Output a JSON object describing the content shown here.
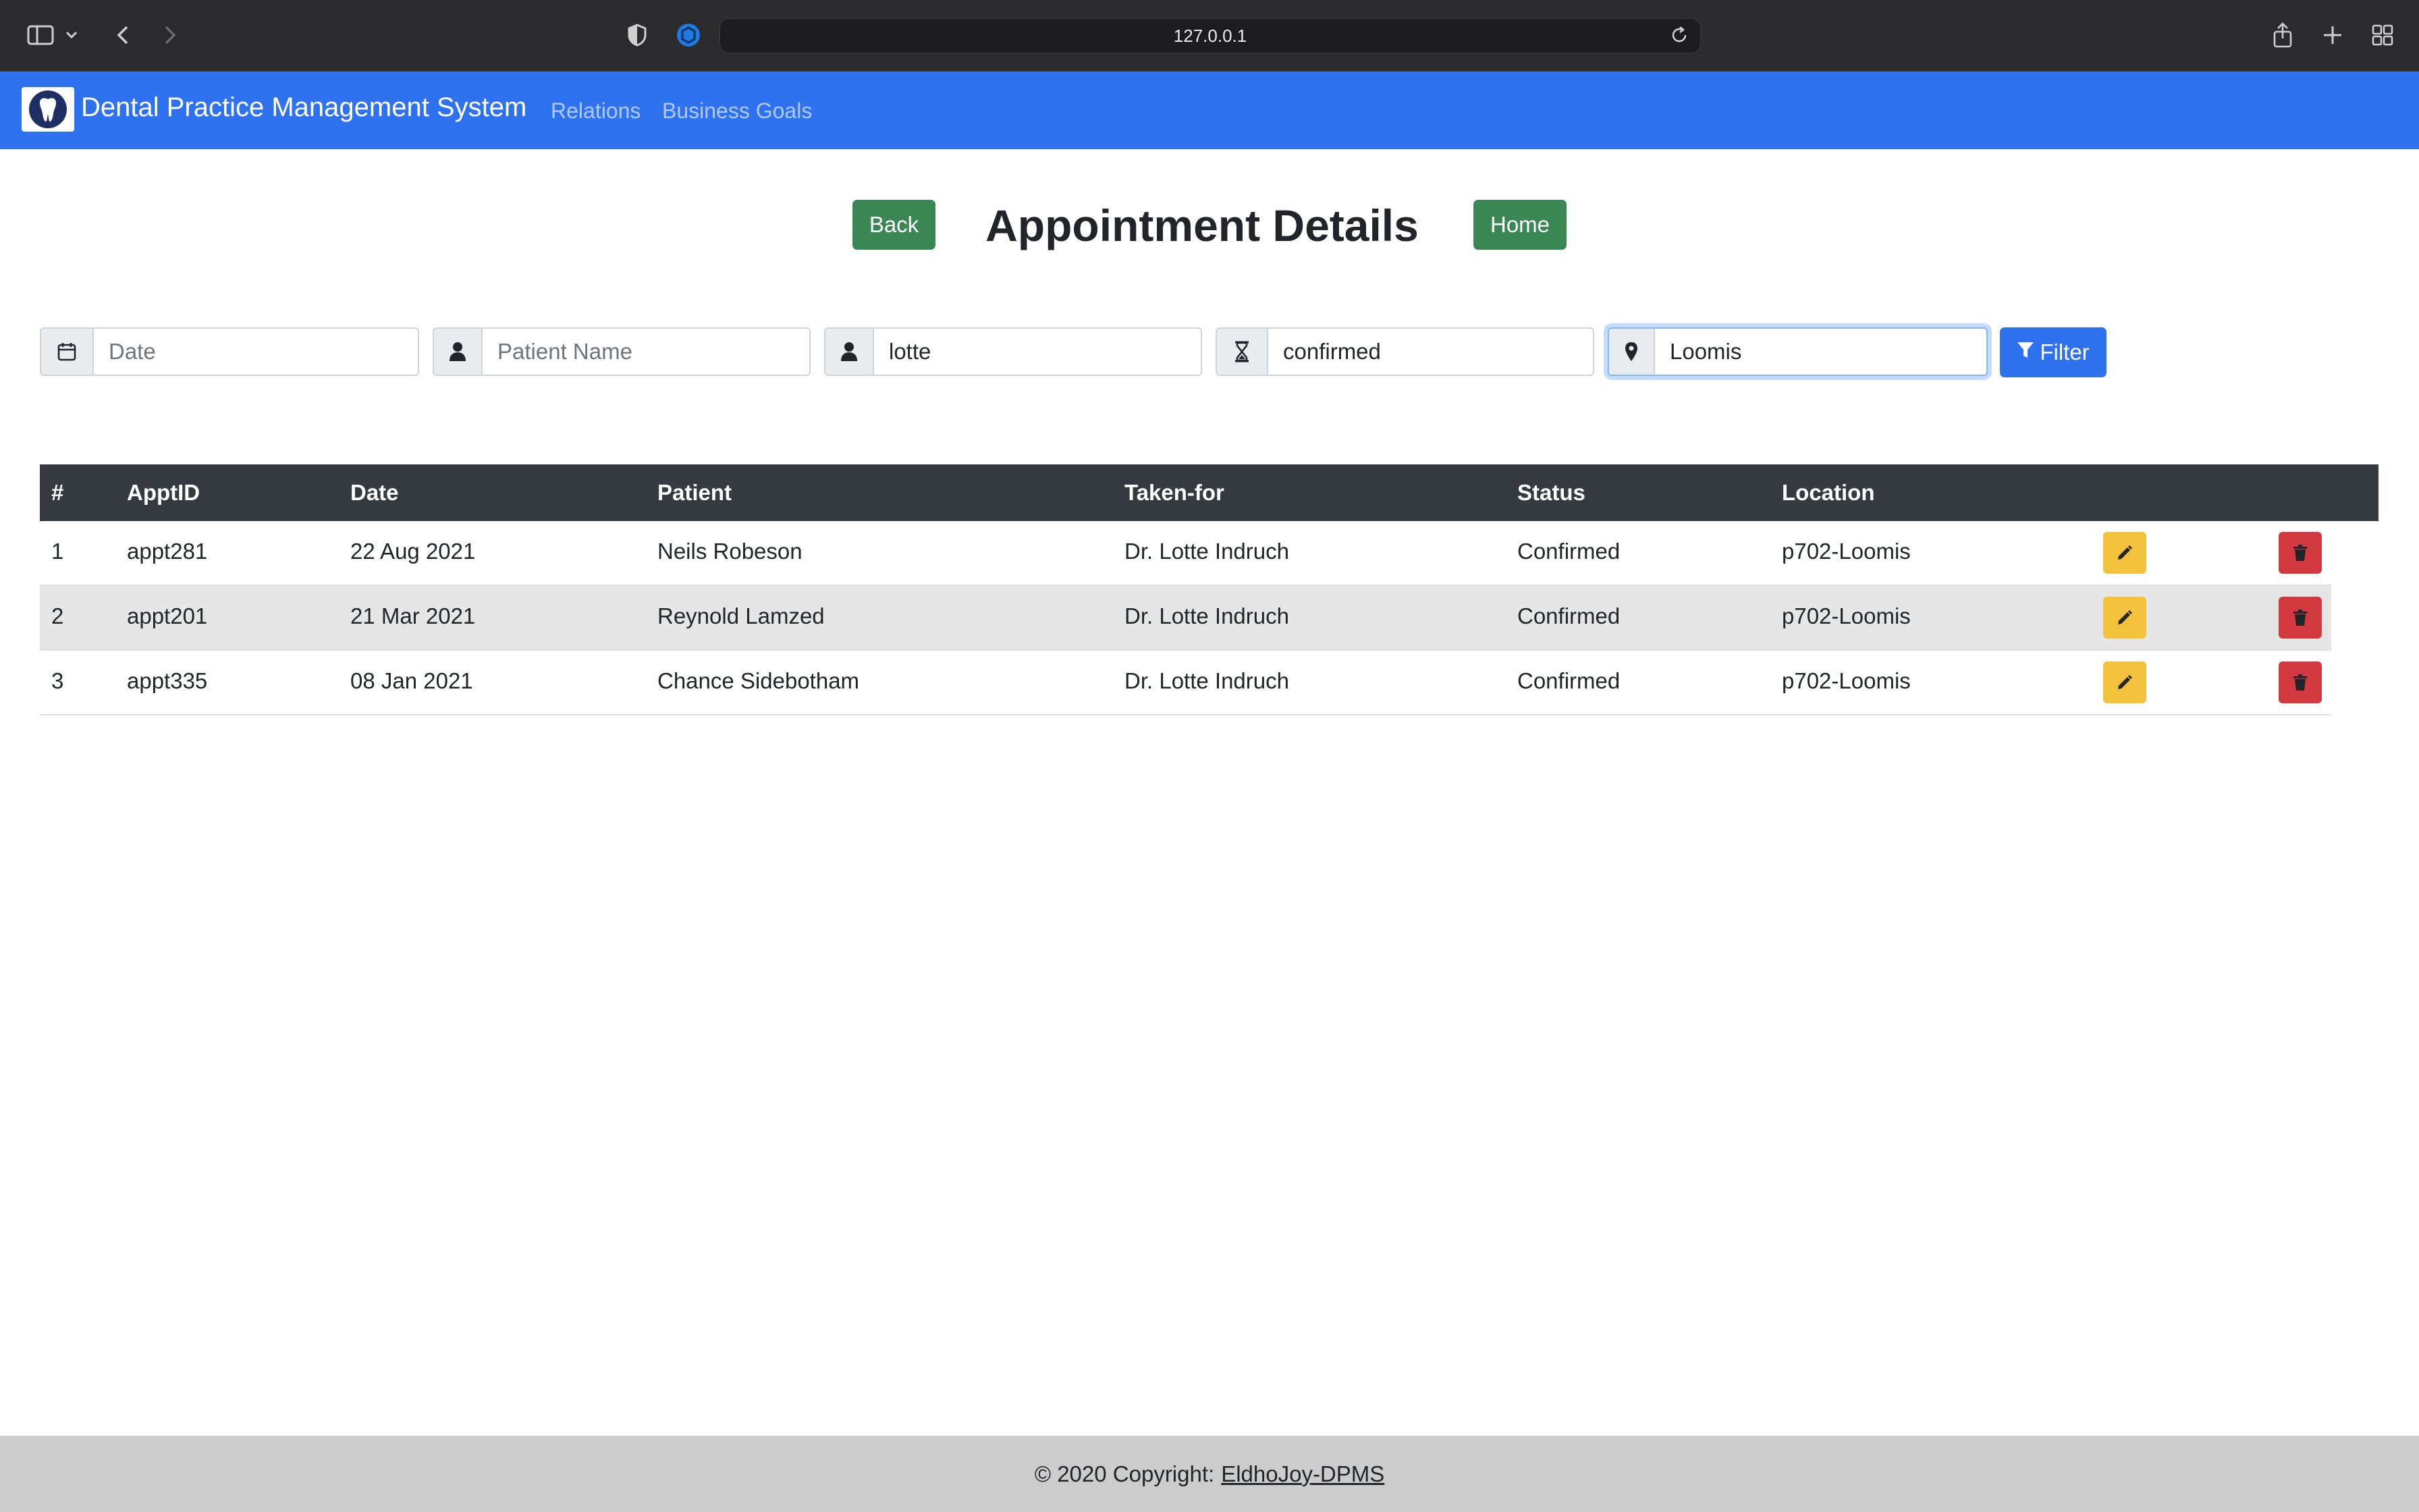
{
  "browser": {
    "url": "127.0.0.1"
  },
  "navbar": {
    "brand": "Dental Practice Management System",
    "links": [
      "Relations",
      "Business Goals"
    ]
  },
  "header": {
    "back_label": "Back",
    "title": "Appointment Details",
    "home_label": "Home"
  },
  "filters": {
    "date": {
      "value": "",
      "placeholder": "Date",
      "icon": "calendar-icon"
    },
    "patient": {
      "value": "",
      "placeholder": "Patient Name",
      "icon": "user-icon"
    },
    "doctor": {
      "value": "lotte",
      "placeholder": "",
      "icon": "user-icon"
    },
    "status": {
      "value": "confirmed",
      "placeholder": "",
      "icon": "hourglass-icon"
    },
    "location": {
      "value": "Loomis",
      "placeholder": "",
      "icon": "map-pin-icon"
    },
    "filter_label": "Filter"
  },
  "table": {
    "columns": [
      "#",
      "ApptID",
      "Date",
      "Patient",
      "Taken-for",
      "Status",
      "Location"
    ],
    "rows": [
      {
        "num": "1",
        "id": "appt281",
        "date": "22 Aug 2021",
        "patient": "Neils Robeson",
        "taken_for": "Dr. Lotte Indruch",
        "status": "Confirmed",
        "location": "p702-Loomis"
      },
      {
        "num": "2",
        "id": "appt201",
        "date": "21 Mar 2021",
        "patient": "Reynold Lamzed",
        "taken_for": "Dr. Lotte Indruch",
        "status": "Confirmed",
        "location": "p702-Loomis"
      },
      {
        "num": "3",
        "id": "appt335",
        "date": "08 Jan 2021",
        "patient": "Chance Sidebotham",
        "taken_for": "Dr. Lotte Indruch",
        "status": "Confirmed",
        "location": "p702-Loomis"
      }
    ]
  },
  "footer": {
    "prefix": "© 2020 Copyright:",
    "link": "EldhoJoy-DPMS"
  },
  "colors": {
    "navbar": "#2f72ef",
    "success": "#3a8754",
    "warning": "#f3c23d",
    "danger": "#d2393f",
    "table_head": "#343a40"
  }
}
